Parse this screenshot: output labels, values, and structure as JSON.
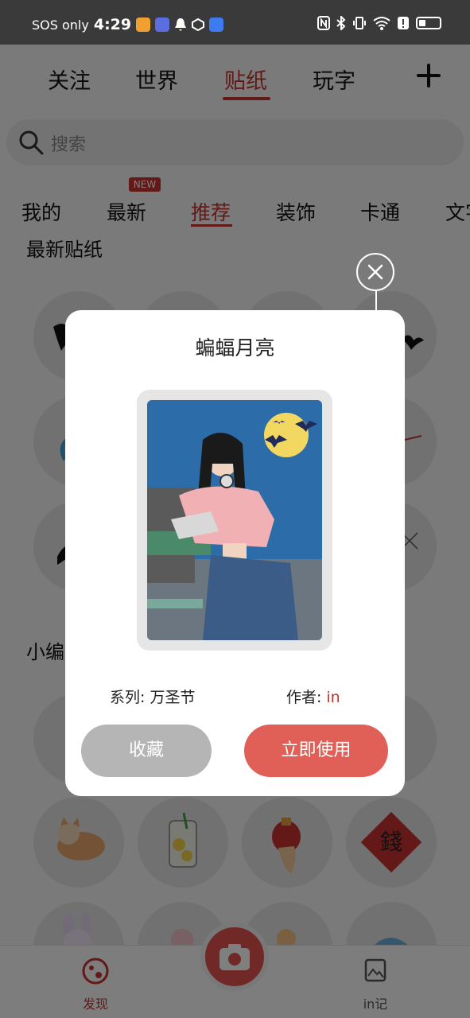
{
  "status_bar": {
    "carrier": "SOS only",
    "time": "4:29"
  },
  "top_tabs": [
    {
      "label": "关注"
    },
    {
      "label": "世界"
    },
    {
      "label": "贴纸"
    },
    {
      "label": "玩字"
    }
  ],
  "search": {
    "placeholder": "搜索"
  },
  "category_tabs": [
    {
      "label": "我的"
    },
    {
      "label": "最新",
      "badge": "NEW"
    },
    {
      "label": "推荐"
    },
    {
      "label": "装饰"
    },
    {
      "label": "卡通"
    },
    {
      "label": "文字"
    }
  ],
  "sections": {
    "latest_title": "最新贴纸",
    "editor_title": "小编"
  },
  "dialog": {
    "title": "蝙蝠月亮",
    "series_label": "系列: 万圣节",
    "author_label": "作者:",
    "author_name": "in",
    "collect_button": "收藏",
    "use_button": "立即使用"
  },
  "bottom_nav": {
    "discover": "发现",
    "in_diary": "in记"
  },
  "colors": {
    "accent": "#c4332f",
    "use_button": "#e06058",
    "collect_button": "#b5b5b5"
  }
}
